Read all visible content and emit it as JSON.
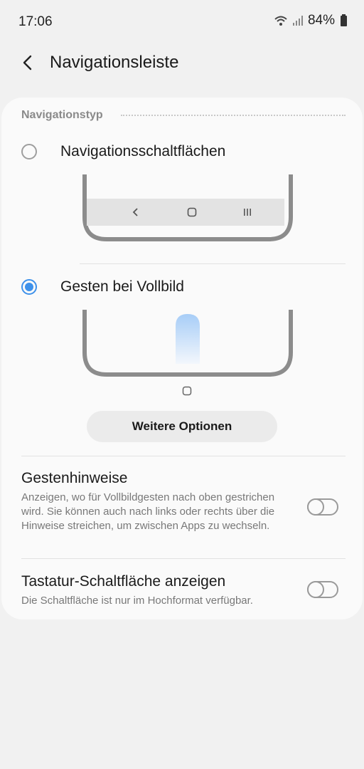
{
  "status_bar": {
    "time": "17:06",
    "battery_percent": "84%",
    "icons": [
      "wifi-icon",
      "signal-icon",
      "battery-icon"
    ]
  },
  "header": {
    "title": "Navigationsleiste",
    "back_icon": "back-arrow-icon"
  },
  "section": {
    "title": "Navigationstyp"
  },
  "options": [
    {
      "label": "Navigationsschaltflächen",
      "selected": false
    },
    {
      "label": "Gesten bei Vollbild",
      "selected": true
    }
  ],
  "more_button": {
    "label": "Weitere Optionen"
  },
  "settings": [
    {
      "title": "Gestenhinweise",
      "description": "Anzeigen, wo für Vollbildgesten nach oben gestrichen wird. Sie können auch nach links oder rechts über die Hinweise streichen, um zwischen Apps zu wechseln.",
      "enabled": false
    },
    {
      "title": "Tastatur-Schaltfläche anzeigen",
      "description": "Die Schaltfläche ist nur im Hochformat verfügbar.",
      "enabled": false
    }
  ],
  "colors": {
    "accent": "#3e91ea",
    "background": "#f1f1f1",
    "card": "#fafafa",
    "secondary_text": "#787878"
  }
}
